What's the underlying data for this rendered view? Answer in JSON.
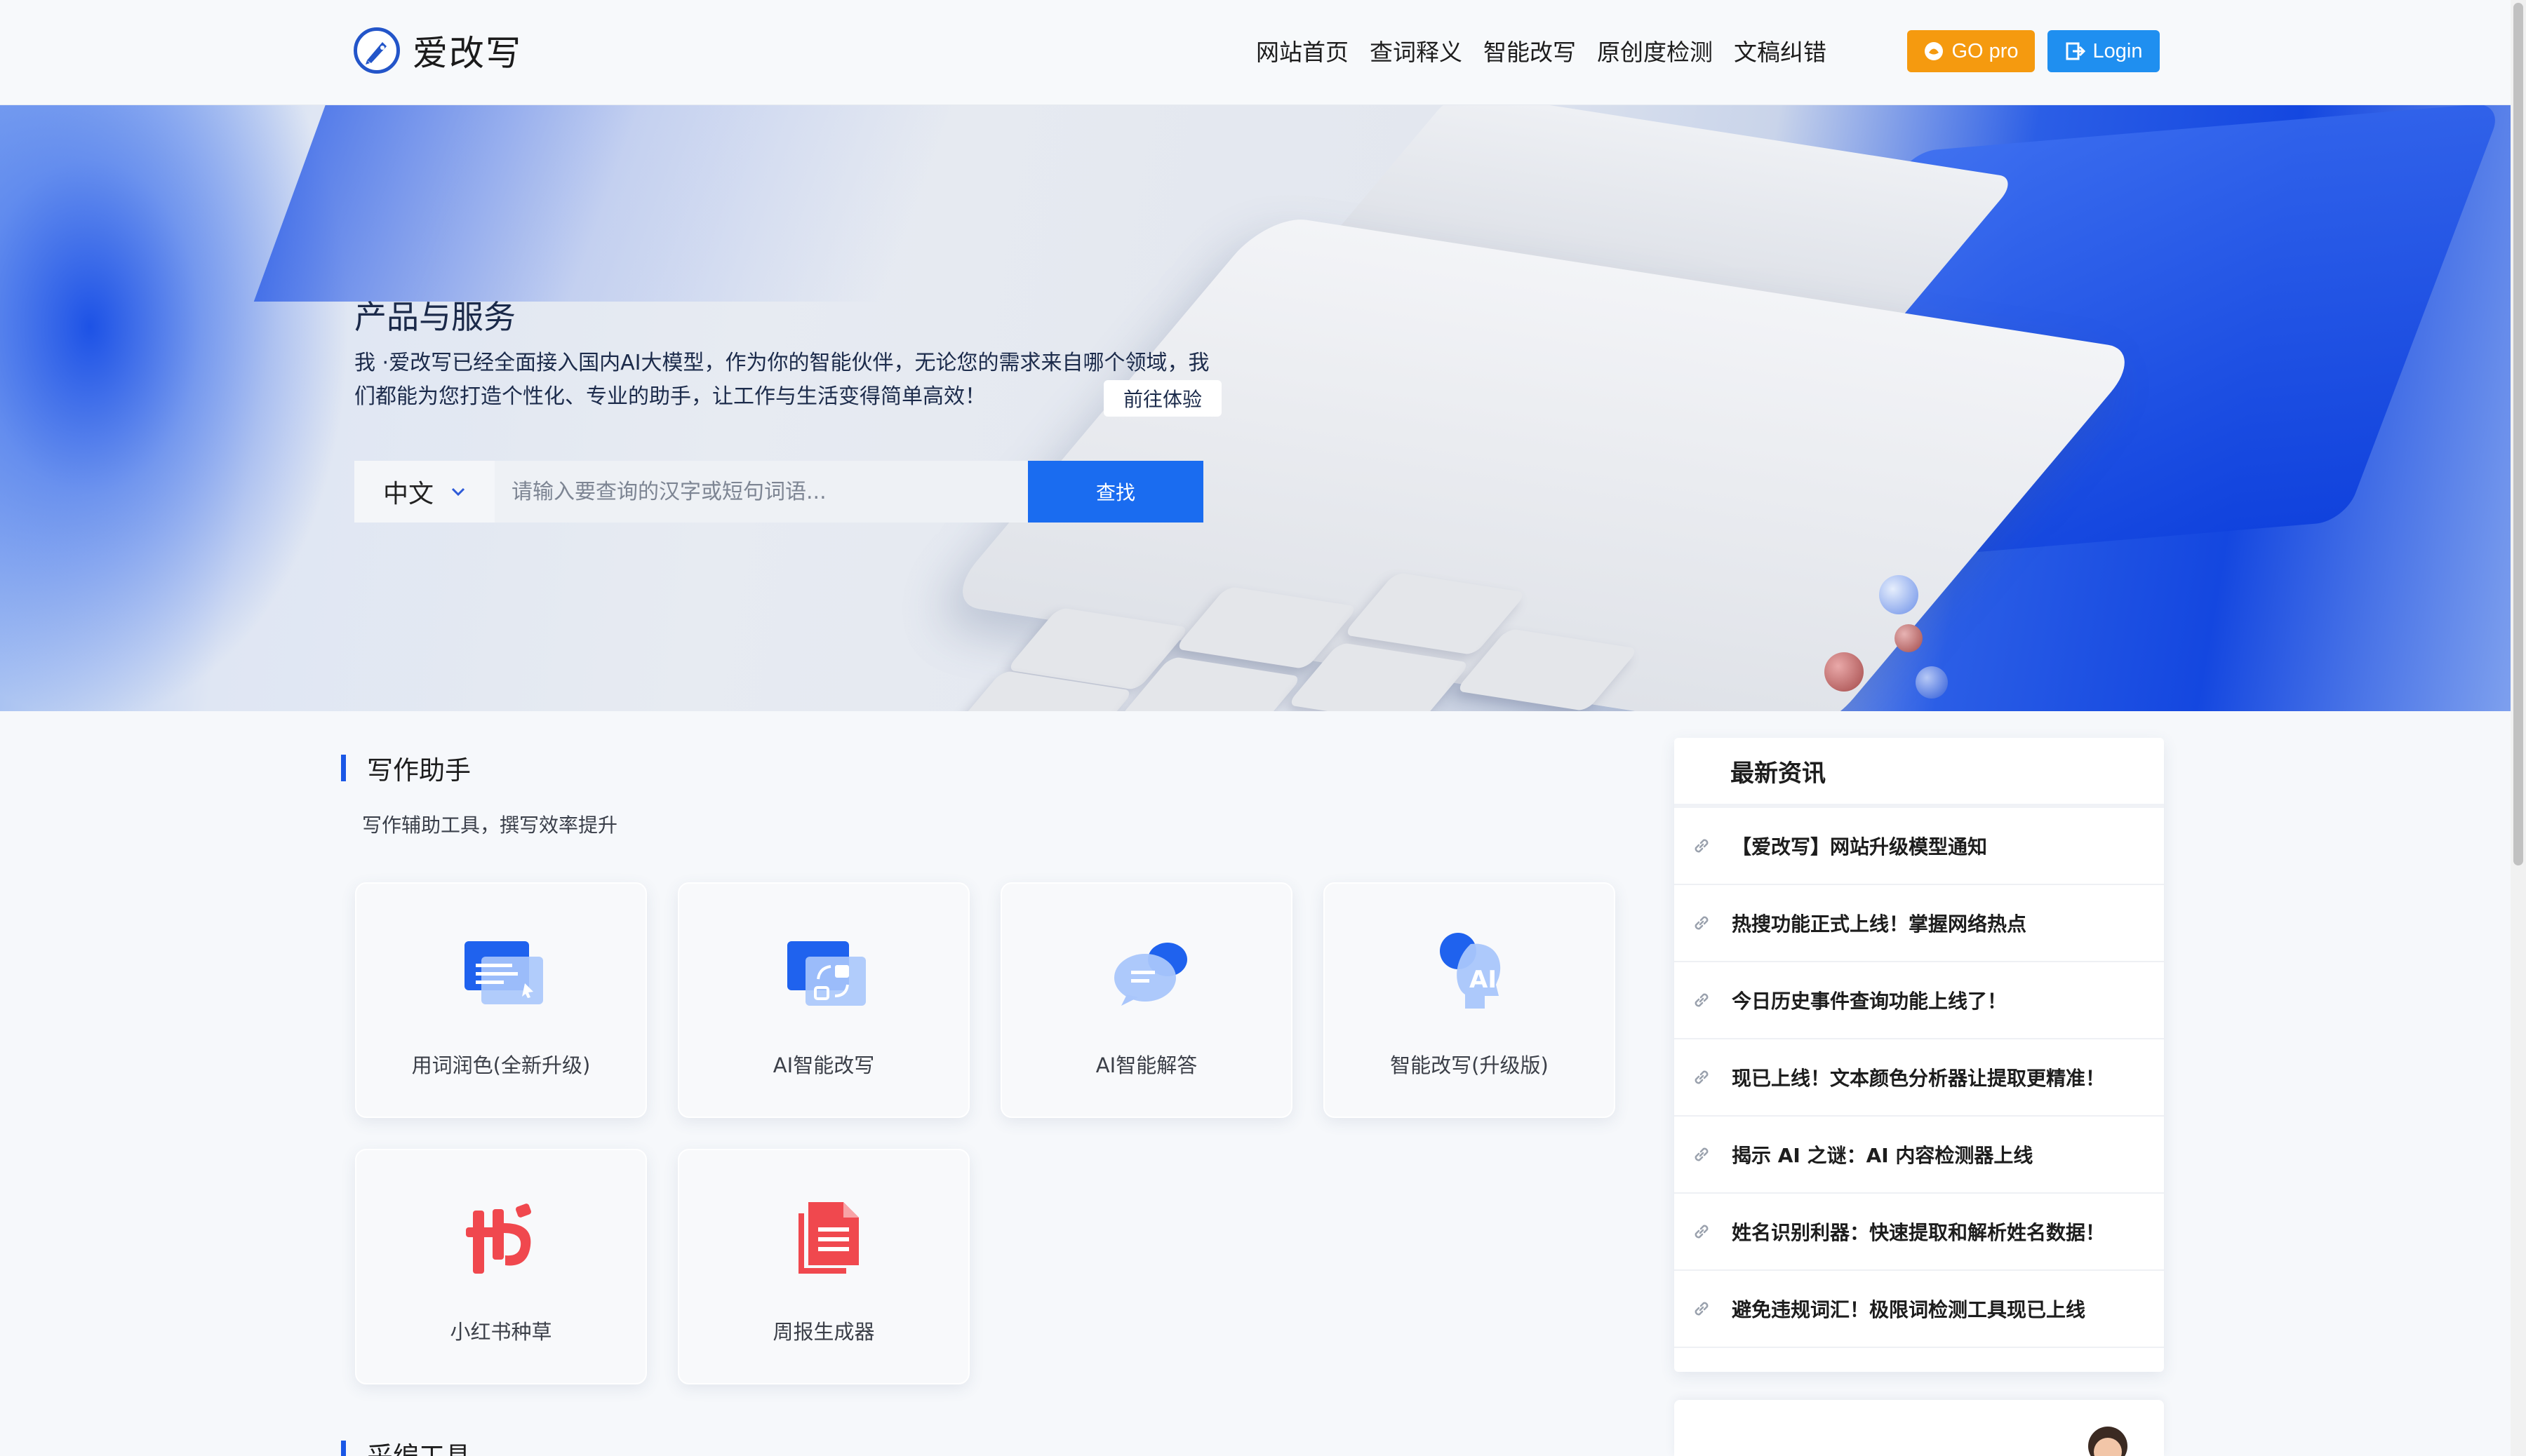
{
  "header": {
    "logo_text": "爱改写",
    "nav": [
      "网站首页",
      "查词释义",
      "智能改写",
      "原创度检测",
      "文稿纠错"
    ],
    "pro_label": "GO pro",
    "login_label": "Login"
  },
  "hero": {
    "title": "产品与服务",
    "description": "我 ·爱改写已经全面接入国内AI大模型，作为你的智能伙伴，无论您的需求来自哪个领域，我们都能为您打造个性化、专业的助手，让工作与生活变得简单高效！",
    "try_label": "前往体验",
    "lang_value": "中文",
    "search_placeholder": "请输入要查询的汉字或短句词语...",
    "search_button": "查找"
  },
  "writing": {
    "title": "写作助手",
    "subtitle": "写作辅助工具，撰写效率提升",
    "cards": [
      {
        "label": "用词润色(全新升级)",
        "icon": "document-edit-icon"
      },
      {
        "label": "AI智能改写",
        "icon": "rewrite-icon"
      },
      {
        "label": "AI智能解答",
        "icon": "chat-bubble-icon"
      },
      {
        "label": "智能改写(升级版)",
        "icon": "ai-head-icon"
      },
      {
        "label": "小红书种草",
        "icon": "xiaohongshu-icon"
      },
      {
        "label": "周报生成器",
        "icon": "report-icon"
      }
    ]
  },
  "section2": {
    "title": "采编工具"
  },
  "news": {
    "title": "最新资讯",
    "items": [
      "【爱改写】网站升级模型通知",
      "热搜功能正式上线！掌握网络热点",
      "今日历史事件查询功能上线了！",
      "现已上线！文本颜色分析器让提取更精准！",
      "揭示 AI 之谜：AI 内容检测器上线",
      "姓名识别利器：快速提取和解析姓名数据！",
      "避免违规词汇！极限词检测工具现已上线"
    ]
  },
  "colors": {
    "primary": "#1a6cf0",
    "pro": "#f59a0f",
    "login": "#1f8ff0",
    "accent_bar": "#1a57e6",
    "red_icon": "#f0484e"
  }
}
